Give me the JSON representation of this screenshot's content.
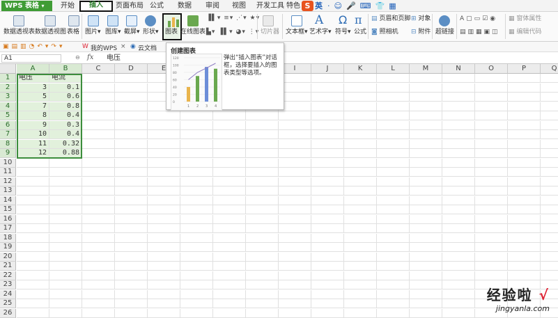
{
  "app_title": "WPS 表格",
  "tabs": [
    "开始",
    "插入",
    "页面布局",
    "公式",
    "数据",
    "审阅",
    "视图",
    "开发工具",
    "特色"
  ],
  "ime": {
    "brand": "S",
    "lang": "英"
  },
  "ribbon": {
    "pivot_table": "数据透视表",
    "pivot_chart": "数据透视图",
    "table": "表格",
    "picture": "图片",
    "gallery": "图库",
    "screenshot": "截屏",
    "shapes": "形状",
    "chart": "图表",
    "online_chart": "在线图表",
    "slicer": "切片器",
    "textbox": "文本框",
    "wordart": "艺术字",
    "symbol": "符号",
    "formula": "公式",
    "header_footer": "页眉和页脚",
    "object": "对象",
    "camera": "照相机",
    "attachment": "附件",
    "hyperlink": "超链接",
    "form_props": "窗体属性",
    "edit_code": "编辑代码"
  },
  "doc_tabs": [
    "我的WPS",
    "云文档"
  ],
  "formula_bar": {
    "name_box": "A1",
    "fx": "fx",
    "content": "电压"
  },
  "tooltip": {
    "title": "创建图表",
    "description": "弹出“插入图表”对话框，选择要插入的图表类型等选项。",
    "preview_axis": [
      "120",
      "100",
      "80",
      "60",
      "40",
      "20",
      "0"
    ],
    "preview_x": [
      "1",
      "2",
      "3",
      "4"
    ]
  },
  "chart_data": {
    "type": "bar",
    "title": "",
    "categories": [
      "1",
      "2",
      "3",
      "4"
    ],
    "series": [
      {
        "values": [
          40,
          70,
          95,
          90
        ]
      }
    ],
    "line": [
      60,
      80,
      92,
      105
    ],
    "ylim": [
      0,
      120
    ],
    "colors": [
      "#e9b44c",
      "#6aa84f",
      "#6d8ed8",
      "#6aa84f"
    ]
  },
  "columns": [
    "A",
    "B",
    "C",
    "D",
    "E",
    "F",
    "G",
    "H",
    "I",
    "J",
    "K",
    "L",
    "M",
    "N",
    "O",
    "P",
    "Q"
  ],
  "sheet_rows": [
    [
      "电压",
      "电流"
    ],
    [
      "3",
      "0.1"
    ],
    [
      "5",
      "0.6"
    ],
    [
      "7",
      "0.8"
    ],
    [
      "8",
      "0.4"
    ],
    [
      "9",
      "0.3"
    ],
    [
      "10",
      "0.4"
    ],
    [
      "11",
      "0.32"
    ],
    [
      "12",
      "0.88"
    ]
  ],
  "row_count": 26,
  "watermark": {
    "line1": "经验啦",
    "line2": "jingyanla.com"
  },
  "colors": {
    "accent": "#3f9c35",
    "selection": "#e2f1dc"
  }
}
